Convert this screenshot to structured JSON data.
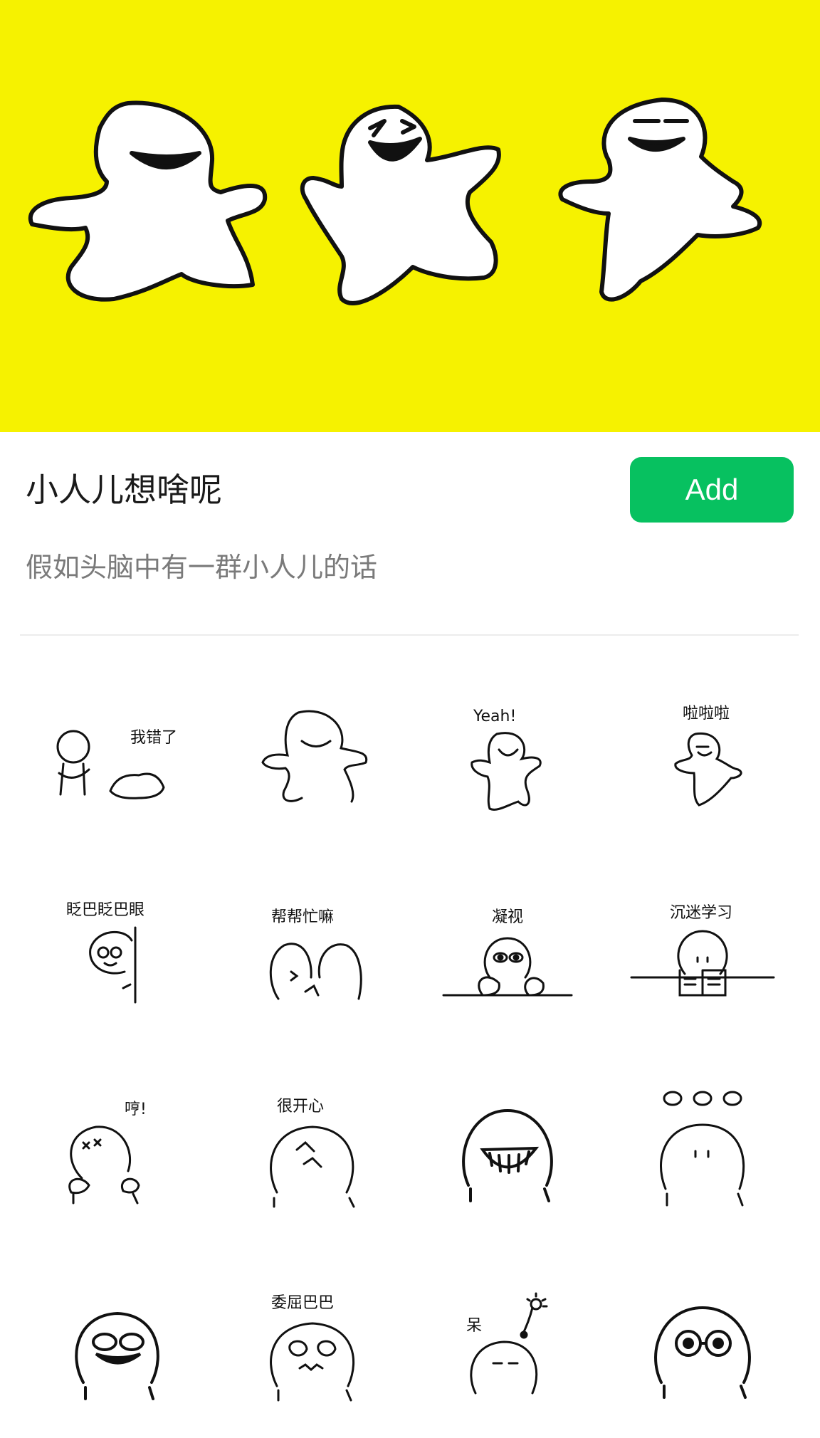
{
  "banner": {
    "background_color": "#F6F200",
    "art": "three dancing doodle people"
  },
  "pack": {
    "title": "小人儿想啥呢",
    "description": "假如头脑中有一群小人儿的话",
    "add_label": "Add",
    "add_color": "#07C160"
  },
  "stickers": [
    {
      "caption": "我错了",
      "icon": "sorry-bow-sticker"
    },
    {
      "caption": "",
      "icon": "dancing-person-sticker"
    },
    {
      "caption": "Yeah!",
      "icon": "yeah-cheer-sticker"
    },
    {
      "caption": "啦啦啦",
      "icon": "lalala-dance-sticker"
    },
    {
      "caption": "眨巴眨巴眼",
      "icon": "peek-blink-sticker"
    },
    {
      "caption": "帮帮忙嘛",
      "icon": "help-please-sticker"
    },
    {
      "caption": "凝视",
      "icon": "stare-sticker"
    },
    {
      "caption": "沉迷学习",
      "icon": "study-sticker"
    },
    {
      "caption": "哼!",
      "icon": "angry-hmph-sticker"
    },
    {
      "caption": "很开心",
      "icon": "happy-face-sticker"
    },
    {
      "caption": "",
      "icon": "big-grin-sticker"
    },
    {
      "caption": "",
      "icon": "speechless-dots-sticker"
    },
    {
      "caption": "",
      "icon": "laughing-tears-sticker"
    },
    {
      "caption": "委屈巴巴",
      "icon": "aggrieved-sticker"
    },
    {
      "caption": "呆",
      "icon": "dazed-sticker"
    },
    {
      "caption": "",
      "icon": "wide-eyes-sticker"
    }
  ]
}
